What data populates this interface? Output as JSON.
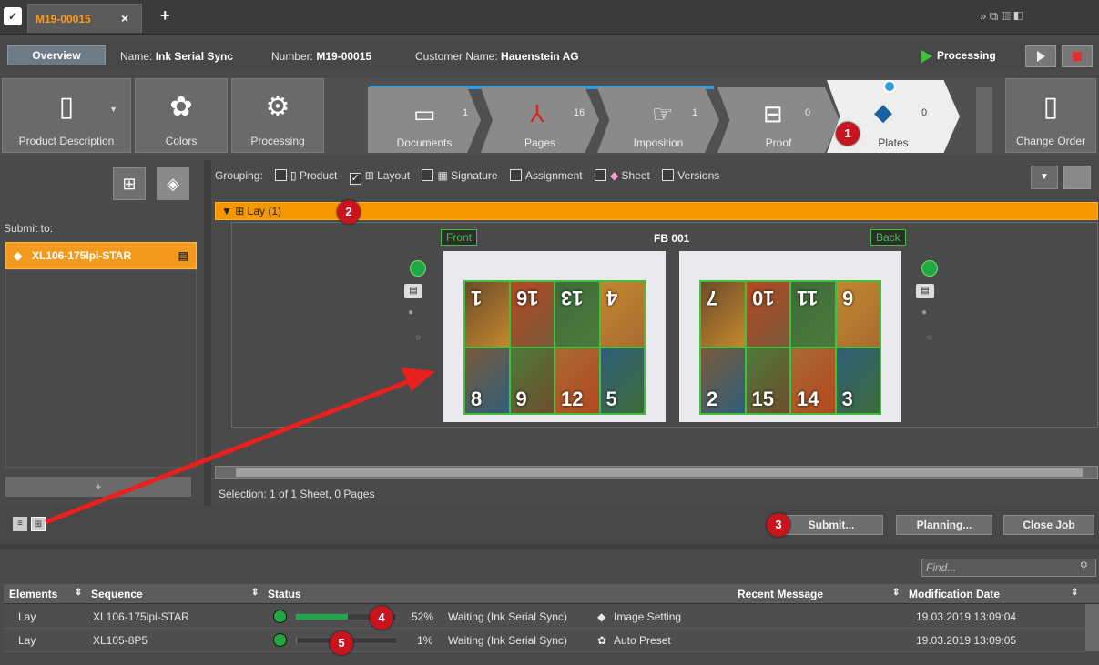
{
  "window": {
    "tab_title": "M19-00015",
    "tab_close": "×",
    "new_tab": "+",
    "header_icons": "»  ⧉ ▥ ◧"
  },
  "info": {
    "overview": "Overview",
    "name_label": "Name:",
    "name": "Ink Serial Sync",
    "number_label": "Number:",
    "number": "M19-00015",
    "customer_label": "Customer Name:",
    "customer": "Hauenstein AG",
    "status": "Processing"
  },
  "workflow": {
    "left_buttons": [
      {
        "label": "Product Description",
        "icon": "product-icon"
      },
      {
        "label": "Colors",
        "icon": "colors-icon"
      },
      {
        "label": "Processing",
        "icon": "processing-icon"
      }
    ],
    "steps": [
      {
        "label": "Documents",
        "count": "1"
      },
      {
        "label": "Pages",
        "count": "16"
      },
      {
        "label": "Imposition",
        "count": "1"
      },
      {
        "label": "Proof",
        "count": "0"
      },
      {
        "label": "Plates",
        "count": "0",
        "active": true
      }
    ],
    "right_button": "Change Order"
  },
  "badges": [
    "1",
    "2",
    "3",
    "4",
    "5"
  ],
  "left": {
    "submit_to": "Submit to:",
    "device": "XL106-175lpi-STAR",
    "add": "+"
  },
  "grouping": {
    "label": "Grouping:",
    "options": [
      {
        "label": "Product",
        "checked": false
      },
      {
        "label": "Layout",
        "checked": true
      },
      {
        "label": "Signature",
        "checked": false
      },
      {
        "label": "Assignment",
        "checked": false
      },
      {
        "label": "Sheet",
        "checked": false
      },
      {
        "label": "Versions",
        "checked": false
      }
    ]
  },
  "lay": {
    "label": "Lay (1)"
  },
  "sheet": {
    "front": "Front",
    "back": "Back",
    "name": "FB 001",
    "front_pages": [
      "1",
      "16",
      "13",
      "4",
      "8",
      "9",
      "12",
      "5"
    ],
    "back_pages": [
      "7",
      "10",
      "11",
      "6",
      "2",
      "15",
      "14",
      "3"
    ]
  },
  "selection": "Selection:  1 of 1 Sheet,  0 Pages",
  "actions": {
    "submit": "Submit...",
    "planning": "Planning...",
    "close": "Close Job"
  },
  "table": {
    "find_placeholder": "Find...",
    "headers": [
      "Elements",
      "Sequence",
      "Status",
      "Recent Message",
      "Modification Date"
    ],
    "rows": [
      {
        "element": "Lay",
        "sequence": "XL106-175lpi-STAR",
        "progress": 52,
        "percent": "52%",
        "status": "Waiting (Ink Serial Sync)",
        "step": "Image Setting",
        "message": "",
        "date": "19.03.2019 13:09:04"
      },
      {
        "element": "Lay",
        "sequence": "XL105-8P5",
        "progress": 1,
        "percent": "1%",
        "status": "Waiting (Ink Serial Sync)",
        "step": "Auto Preset",
        "message": "",
        "date": "19.03.2019 13:09:05"
      }
    ]
  },
  "colors": {
    "accent": "#f59800",
    "badge": "#c8141e",
    "ok": "#21a843",
    "step_blue": "#2f9de0"
  }
}
